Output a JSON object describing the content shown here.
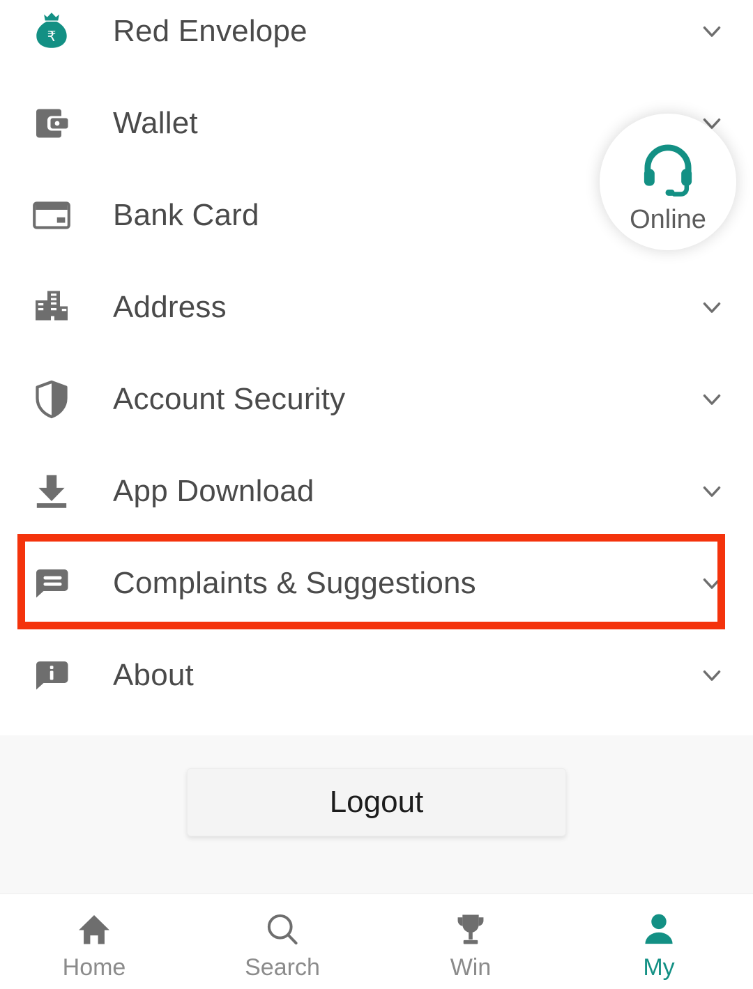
{
  "colors": {
    "accent_teal": "#139084",
    "highlight_red": "#f4330c",
    "icon_gray": "#6e6e6e",
    "label_gray": "#4a4a4a",
    "inactive_tab": "#8b8b8b",
    "logout_bg": "#f4f4f4",
    "section_bg": "#f8f8f8"
  },
  "menu": {
    "items": [
      {
        "label": "Red Envelope",
        "icon": "money-bag-rupee-icon",
        "chevron": "chevron-down-icon",
        "highlighted": false
      },
      {
        "label": "Wallet",
        "icon": "wallet-icon",
        "chevron": "chevron-down-icon",
        "highlighted": false
      },
      {
        "label": "Bank Card",
        "icon": "bank-card-icon",
        "chevron": "chevron-down-icon",
        "highlighted": false
      },
      {
        "label": "Address",
        "icon": "building-icon",
        "chevron": "chevron-down-icon",
        "highlighted": false
      },
      {
        "label": "Account Security",
        "icon": "shield-icon",
        "chevron": "chevron-down-icon",
        "highlighted": false
      },
      {
        "label": "App Download",
        "icon": "download-icon",
        "chevron": "chevron-down-icon",
        "highlighted": false
      },
      {
        "label": "Complaints & Suggestions",
        "icon": "chat-message-icon",
        "chevron": "chevron-down-icon",
        "highlighted": true
      },
      {
        "label": "About",
        "icon": "info-bubble-icon",
        "chevron": "chevron-down-icon",
        "highlighted": false
      }
    ]
  },
  "support_fab": {
    "label": "Online",
    "icon": "headset-icon"
  },
  "logout": {
    "label": "Logout"
  },
  "tab_bar": {
    "items": [
      {
        "label": "Home",
        "icon": "home-icon",
        "active": false
      },
      {
        "label": "Search",
        "icon": "search-icon",
        "active": false
      },
      {
        "label": "Win",
        "icon": "trophy-icon",
        "active": false
      },
      {
        "label": "My",
        "icon": "person-icon",
        "active": true
      }
    ]
  }
}
